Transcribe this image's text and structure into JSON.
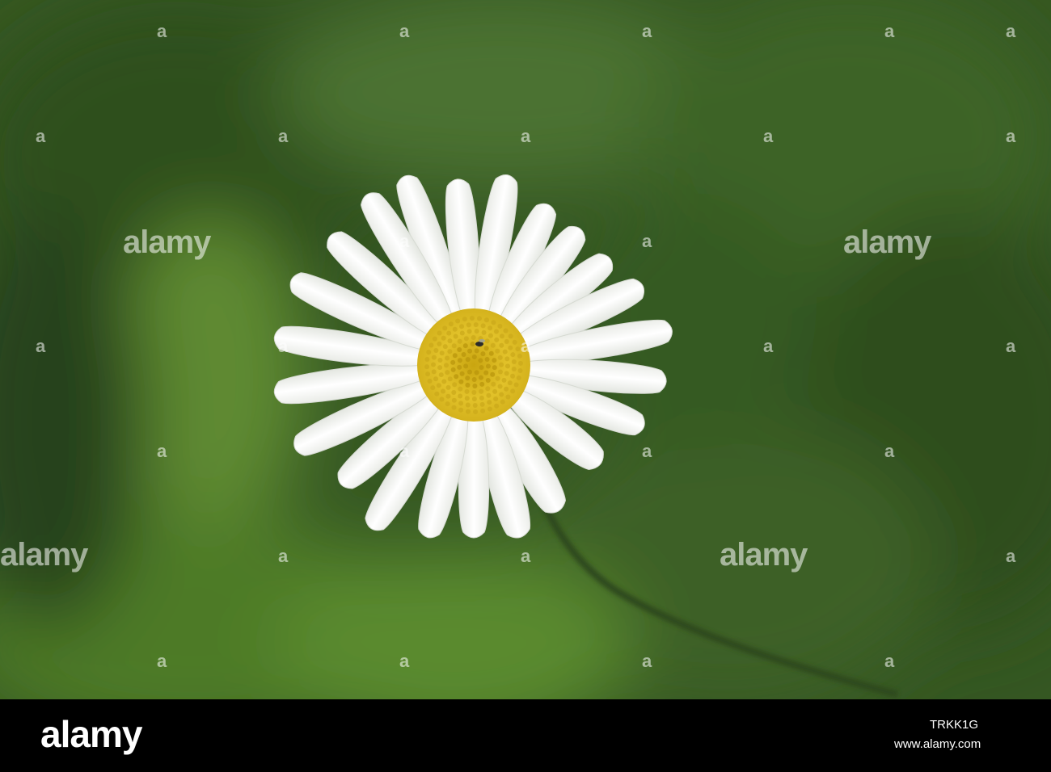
{
  "colors": {
    "background_green": "#3a5a24",
    "petal_white": "#ffffff",
    "disc_yellow": "#d8b418",
    "stem_green": "#2f4a1e"
  },
  "watermark": {
    "logo_text": "alamy",
    "mark_text": "a"
  },
  "footer": {
    "logo": "alamy",
    "image_id": "TRKK1G",
    "url": "www.alamy.com"
  }
}
